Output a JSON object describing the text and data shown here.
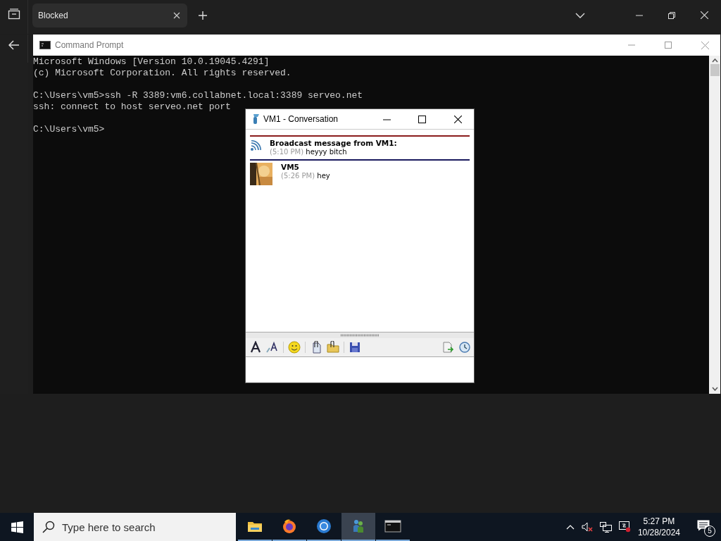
{
  "browser": {
    "tab": {
      "title": "Blocked"
    }
  },
  "console_window": {
    "title": "Command Prompt",
    "blocks": [
      {
        "lines": [
          "Microsoft Windows [Version 10.0.19045.4291]",
          "(c) Microsoft Corporation. All rights reserved."
        ]
      },
      {
        "lines": [
          "C:\\Users\\vm5>ssh -R 3389:vm6.collabnet.local:3389 serveo.net",
          "ssh: connect to host serveo.net port"
        ]
      },
      {
        "lines": [
          "C:\\Users\\vm5>"
        ]
      }
    ]
  },
  "conversation": {
    "title": "VM1 - Conversation",
    "messages": [
      {
        "kind": "broadcast",
        "sender": "Broadcast message from VM1:",
        "time": "(5:10 PM)",
        "text": "heyyy bitch"
      },
      {
        "kind": "user",
        "sender": "VM5",
        "time": "(5:26 PM)",
        "text": "hey"
      }
    ]
  },
  "taskbar": {
    "search": {
      "placeholder": "Type here to search"
    },
    "apps": [
      {
        "kind": "folder",
        "selected": false
      },
      {
        "kind": "firefox",
        "selected": false
      },
      {
        "kind": "chrome",
        "selected": false
      },
      {
        "kind": "messenger",
        "selected": true
      },
      {
        "kind": "console",
        "selected": false
      }
    ],
    "clock": {
      "time": "5:27 PM",
      "date": "10/28/2024"
    },
    "notification_count": "5"
  }
}
